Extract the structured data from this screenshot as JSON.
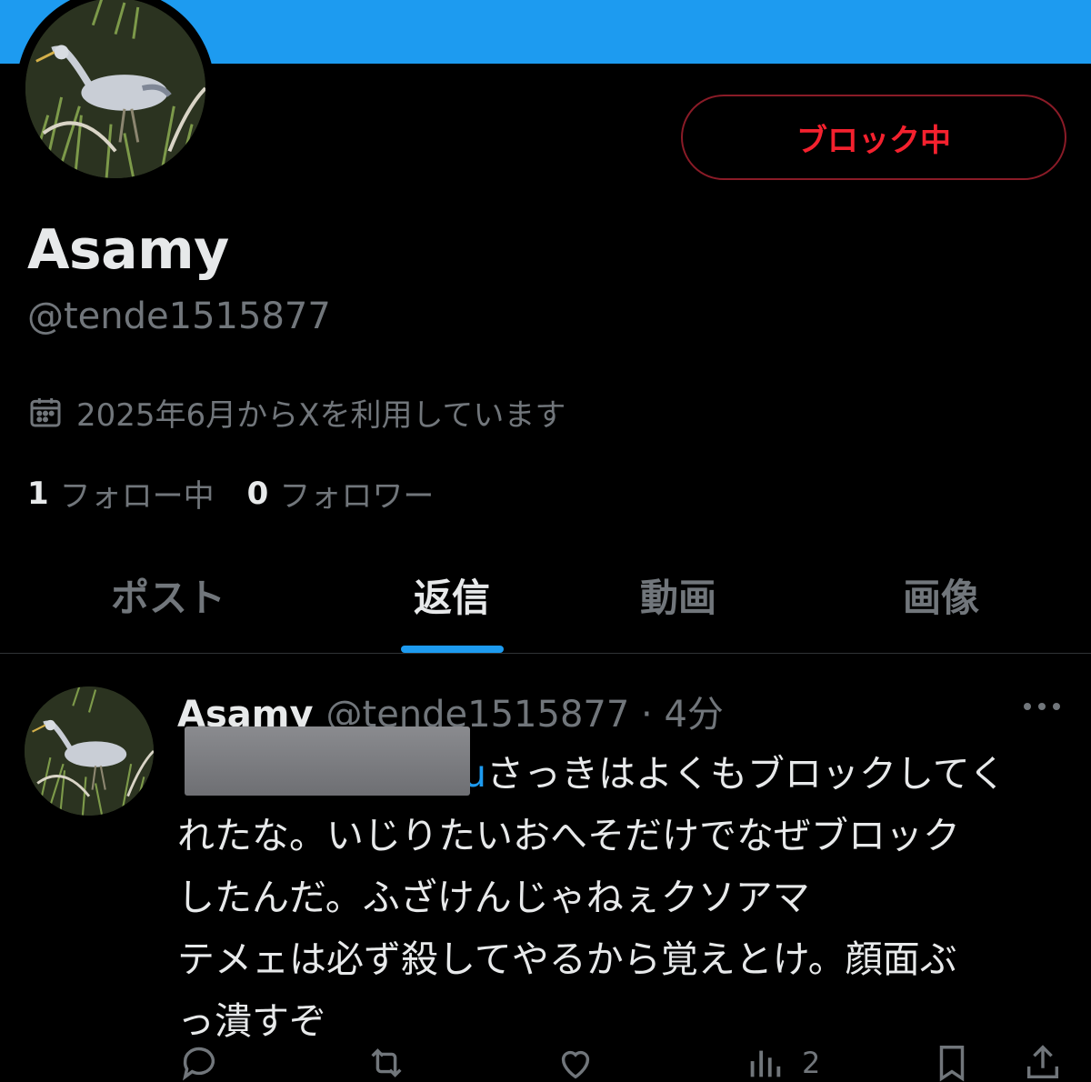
{
  "profile": {
    "banner_color": "#1d9bf0",
    "avatar_alt": "grey-heron-avatar",
    "block_button_label": "ブロック中",
    "display_name": "Asamy",
    "handle": "@tende1515877",
    "joined_text": "2025年6月からXを利用しています",
    "following_count": "1",
    "following_label": "フォロー中",
    "followers_count": "0",
    "followers_label": "フォロワー"
  },
  "tabs": [
    {
      "label": "ポスト",
      "active": false
    },
    {
      "label": "返信",
      "active": true
    },
    {
      "label": "動画",
      "active": false
    },
    {
      "label": "画像",
      "active": false
    }
  ],
  "post": {
    "name": "Asamy",
    "meta": "@tende1515877 · 4分",
    "mention_visible": "u",
    "body_lines": [
      "さっきはよくもブロックしてく",
      "れたな。いじりたいおへそだけでなぜブロック",
      "したんだ。ふざけんじゃねぇクソアマ",
      "テメェは必ず殺してやるから覚えとけ。顔面ぶ",
      "っ潰すぞ"
    ],
    "views_count": "2"
  },
  "colors": {
    "accent": "#1d9bf0",
    "danger": "#f4212e",
    "muted_text": "#71767b",
    "primary_text": "#e7e9ea",
    "background": "#000000"
  },
  "icons": [
    "calendar-icon",
    "more-icon",
    "reply-icon",
    "repost-icon",
    "like-icon",
    "views-icon",
    "bookmark-icon",
    "share-icon"
  ]
}
